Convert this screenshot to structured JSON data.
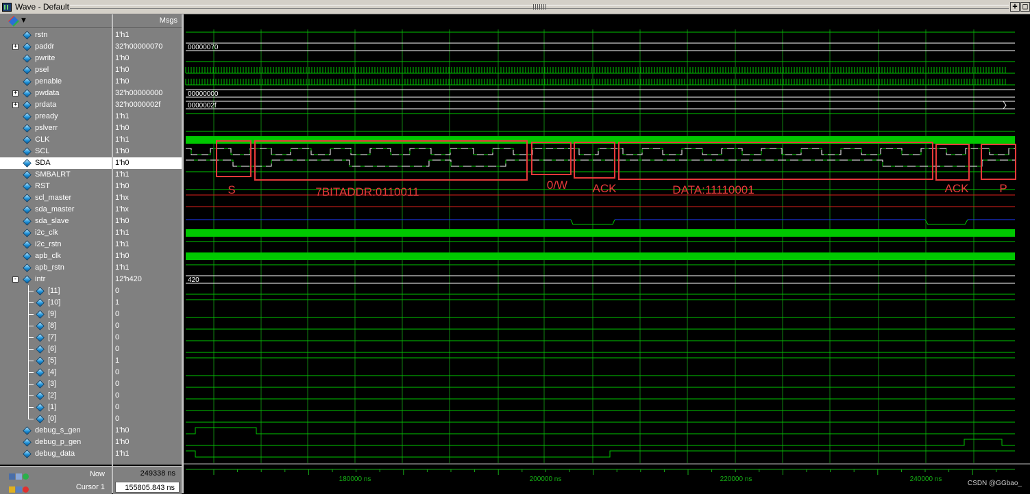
{
  "window": {
    "title": "Wave - Default"
  },
  "header": {
    "msgs_label": "Msgs"
  },
  "signals": [
    {
      "name": "rstn",
      "value": "1'h1"
    },
    {
      "name": "paddr",
      "value": "32'h00000070",
      "bus_text": "00000070"
    },
    {
      "name": "pwrite",
      "value": "1'h0"
    },
    {
      "name": "psel",
      "value": "1'h0"
    },
    {
      "name": "penable",
      "value": "1'h0"
    },
    {
      "name": "pwdata",
      "value": "32'h00000000",
      "bus_text": "00000000"
    },
    {
      "name": "prdata",
      "value": "32'h0000002f",
      "bus_text": "0000002f"
    },
    {
      "name": "pready",
      "value": "1'h1"
    },
    {
      "name": "pslverr",
      "value": "1'h0"
    },
    {
      "name": "CLK",
      "value": "1'h1"
    },
    {
      "name": "SCL",
      "value": "1'h0"
    },
    {
      "name": "SDA",
      "value": "1'h0"
    },
    {
      "name": "SMBALRT",
      "value": "1'h1"
    },
    {
      "name": "RST",
      "value": "1'h0"
    },
    {
      "name": "scl_master",
      "value": "1'hx"
    },
    {
      "name": "sda_master",
      "value": "1'hx"
    },
    {
      "name": "sda_slave",
      "value": "1'h0"
    },
    {
      "name": "i2c_clk",
      "value": "1'h1"
    },
    {
      "name": "i2c_rstn",
      "value": "1'h1"
    },
    {
      "name": "apb_clk",
      "value": "1'h0"
    },
    {
      "name": "apb_rstn",
      "value": "1'h1"
    },
    {
      "name": "intr",
      "value": "12'h420",
      "bus_text": "420"
    },
    {
      "name": "[11]",
      "value": "0"
    },
    {
      "name": "[10]",
      "value": "1"
    },
    {
      "name": "[9]",
      "value": "0"
    },
    {
      "name": "[8]",
      "value": "0"
    },
    {
      "name": "[7]",
      "value": "0"
    },
    {
      "name": "[6]",
      "value": "0"
    },
    {
      "name": "[5]",
      "value": "1"
    },
    {
      "name": "[4]",
      "value": "0"
    },
    {
      "name": "[3]",
      "value": "0"
    },
    {
      "name": "[2]",
      "value": "0"
    },
    {
      "name": "[1]",
      "value": "0"
    },
    {
      "name": "[0]",
      "value": "0"
    },
    {
      "name": "debug_s_gen",
      "value": "1'h0"
    },
    {
      "name": "debug_p_gen",
      "value": "1'h0"
    },
    {
      "name": "debug_data",
      "value": "1'h1"
    }
  ],
  "status": {
    "now_label": "Now",
    "now_value": "249338 ns",
    "cursor_label": "Cursor 1",
    "cursor_value": "155805.843 ns"
  },
  "timeline": {
    "tick_labels": [
      "180000 ns",
      "200000 ns",
      "220000 ns",
      "240000 ns"
    ]
  },
  "annotations": [
    "S",
    "7BITADDR:0110011",
    "0/W",
    "ACK",
    "DATA:11110001",
    "ACK",
    "P"
  ],
  "watermark": "CSDN @GGbao_",
  "colors": {
    "wave_green": "#00c800",
    "bus_white": "#ffffff",
    "x_red": "#e0201c",
    "z_blue": "#1e3cff",
    "annotation_red": "#e83a3a",
    "grid": "#16b016"
  }
}
